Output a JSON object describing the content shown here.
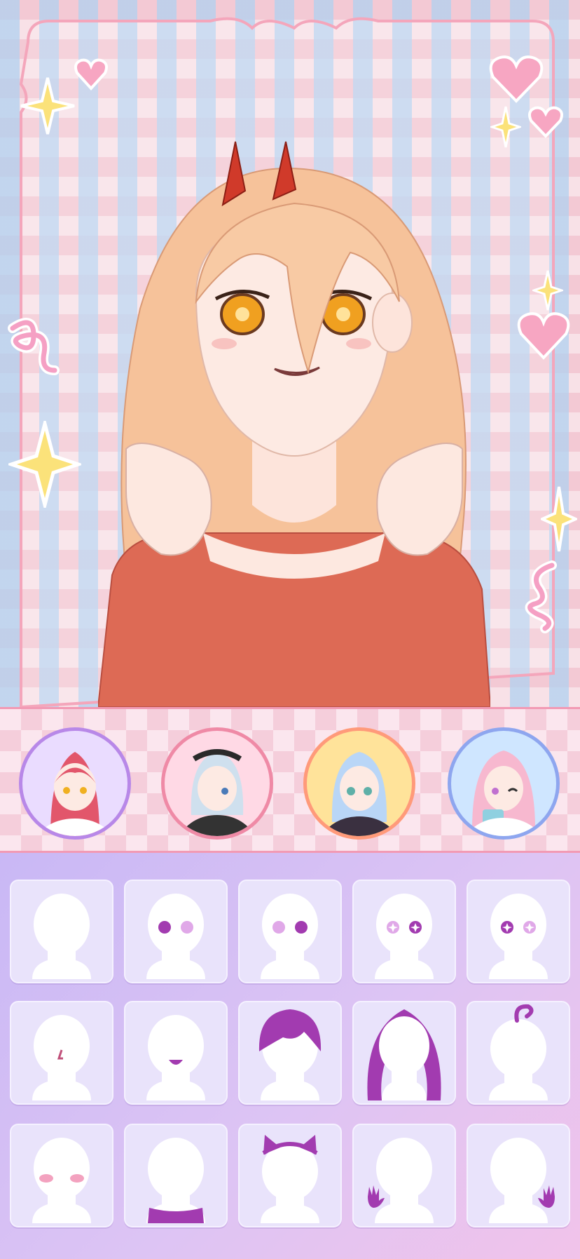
{
  "app": {
    "screen": "avatar-maker-editor"
  },
  "colors": {
    "accent_pink": "#f29ab4",
    "purple": "#a23bb0",
    "hair": "#f6c29a",
    "shirt": "#dd6a55",
    "eyes": "#f0a020"
  },
  "presets": [
    {
      "id": "preset-1",
      "hair": "#e2566b",
      "ring": "#b888e8",
      "bg": "#eadcff"
    },
    {
      "id": "preset-2",
      "hair": "#cfe0ee",
      "ring": "#ef8aa6",
      "bg": "#ffd9e5"
    },
    {
      "id": "preset-3",
      "hair": "#b9d6f7",
      "ring": "#ff9a7a",
      "bg": "#ffe39a"
    },
    {
      "id": "preset-4",
      "hair": "#f7b8cf",
      "ring": "#8ea6ef",
      "bg": "#cfe6ff"
    }
  ],
  "categories": [
    {
      "name": "body-base",
      "icon": "head-silhouette-icon"
    },
    {
      "name": "eye-style-1",
      "icon": "round-eyes-icon"
    },
    {
      "name": "eye-style-2",
      "icon": "round-eyes-alt-icon"
    },
    {
      "name": "eye-style-3",
      "icon": "star-eyes-icon"
    },
    {
      "name": "eye-style-4",
      "icon": "sparkle-eyes-icon"
    },
    {
      "name": "nose",
      "icon": "nose-icon"
    },
    {
      "name": "mouth",
      "icon": "mouth-icon"
    },
    {
      "name": "hair-front",
      "icon": "short-hair-icon"
    },
    {
      "name": "hair-back",
      "icon": "long-hair-icon"
    },
    {
      "name": "ahoge",
      "icon": "hair-curl-icon"
    },
    {
      "name": "blush",
      "icon": "blush-icon"
    },
    {
      "name": "clothing",
      "icon": "shirt-icon"
    },
    {
      "name": "headwear",
      "icon": "cat-ears-icon"
    },
    {
      "name": "hand-left",
      "icon": "left-hand-icon"
    },
    {
      "name": "hand-right",
      "icon": "right-hand-icon"
    }
  ]
}
